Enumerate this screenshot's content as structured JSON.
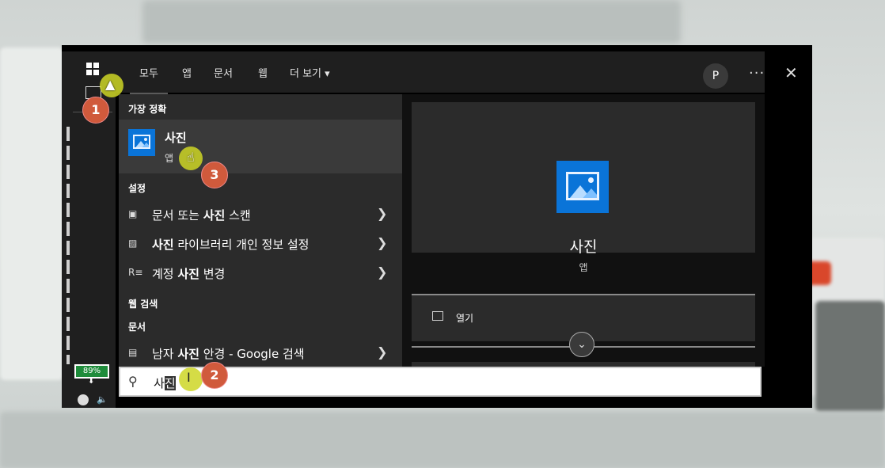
{
  "tabs": [
    "모두",
    "앱",
    "문서",
    "웹",
    "더 보기 ▾"
  ],
  "avatar_letter": "P",
  "more_glyph": "···",
  "close_glyph": "✕",
  "battery": "89%",
  "sections": {
    "best": "가장 정확",
    "settings": "설정",
    "web": "웹 검색",
    "docs": "문서"
  },
  "best_match": {
    "title": "사진",
    "subtitle": "앱"
  },
  "settings_items": [
    {
      "pre": "문서 또는 ",
      "bold": "사진",
      "post": " 스캔",
      "icon": "scanner-icon"
    },
    {
      "pre": "",
      "bold": "사진",
      "post": " 라이브러리 개인 정보 설정",
      "icon": "picture-icon"
    },
    {
      "pre": "계정 ",
      "bold": "사진",
      "post": " 변경",
      "icon": "account-icon"
    }
  ],
  "doc_item": {
    "pre": "남자 ",
    "bold": "사진",
    "post": " 안경 - Google 검색"
  },
  "search": {
    "typed": "사",
    "selected": "진"
  },
  "preview": {
    "title": "사진",
    "subtitle": "앱",
    "open": "열기"
  },
  "markers": [
    "1",
    "2",
    "3"
  ],
  "colors": {
    "accent": "#0a74d8",
    "marker": "#d05a3c",
    "highlight": "#ced626"
  }
}
